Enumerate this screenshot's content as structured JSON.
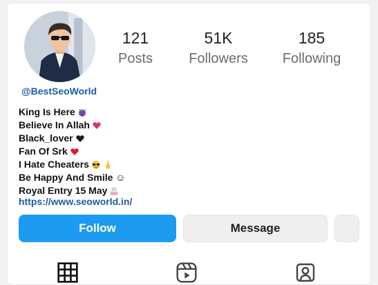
{
  "profile": {
    "username": "@BestSeoWorld",
    "website": "https://www.seoworld.in/"
  },
  "stats": {
    "posts_count": "121",
    "posts_label": "Posts",
    "followers_count": "51K",
    "followers_label": "Followers",
    "following_count": "185",
    "following_label": "Following"
  },
  "bio": [
    {
      "text": "King Is Here",
      "icon": "devil-emoji"
    },
    {
      "text": "Believe In Allah",
      "icon": "sparkling-heart-emoji"
    },
    {
      "text": "Black_lover",
      "icon": "black-heart-emoji"
    },
    {
      "text": "Fan Of Srk",
      "icon": "red-heart-emoji"
    },
    {
      "text": "I Hate Cheaters",
      "icon": "sunglasses-pointing-emoji"
    },
    {
      "text": "Be Happy And Smile ☺",
      "icon": ""
    },
    {
      "text": "Royal Entry 15 May",
      "icon": "birthday-cake-emoji"
    }
  ],
  "actions": {
    "follow_label": "Follow",
    "message_label": "Message"
  },
  "colors": {
    "follow_button": "#1d9bf0",
    "link": "#1e5aa8"
  },
  "tabs": [
    "grid-icon",
    "reels-icon",
    "tagged-icon"
  ]
}
